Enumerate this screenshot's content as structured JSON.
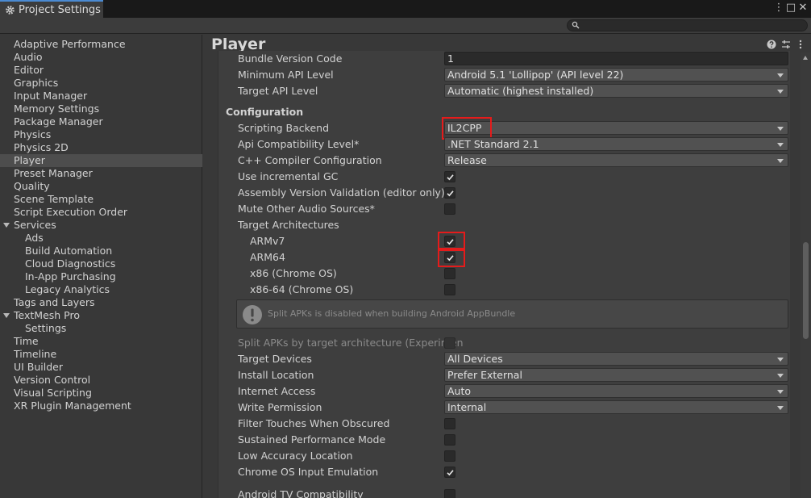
{
  "window": {
    "tab_title": "Project Settings",
    "controls": [
      "⋮",
      "□",
      "✕"
    ]
  },
  "search": {
    "placeholder": "",
    "value": ""
  },
  "sidebar": {
    "items": [
      {
        "label": "Adaptive Performance",
        "indent": 0
      },
      {
        "label": "Audio",
        "indent": 0
      },
      {
        "label": "Editor",
        "indent": 0
      },
      {
        "label": "Graphics",
        "indent": 0
      },
      {
        "label": "Input Manager",
        "indent": 0
      },
      {
        "label": "Memory Settings",
        "indent": 0
      },
      {
        "label": "Package Manager",
        "indent": 0
      },
      {
        "label": "Physics",
        "indent": 0
      },
      {
        "label": "Physics 2D",
        "indent": 0
      },
      {
        "label": "Player",
        "indent": 0,
        "selected": true
      },
      {
        "label": "Preset Manager",
        "indent": 0
      },
      {
        "label": "Quality",
        "indent": 0
      },
      {
        "label": "Scene Template",
        "indent": 0
      },
      {
        "label": "Script Execution Order",
        "indent": 0
      },
      {
        "label": "Services",
        "indent": 0,
        "expanded": true
      },
      {
        "label": "Ads",
        "indent": 1
      },
      {
        "label": "Build Automation",
        "indent": 1
      },
      {
        "label": "Cloud Diagnostics",
        "indent": 1
      },
      {
        "label": "In-App Purchasing",
        "indent": 1
      },
      {
        "label": "Legacy Analytics",
        "indent": 1
      },
      {
        "label": "Tags and Layers",
        "indent": 0
      },
      {
        "label": "TextMesh Pro",
        "indent": 0,
        "expanded": true
      },
      {
        "label": "Settings",
        "indent": 1
      },
      {
        "label": "Time",
        "indent": 0
      },
      {
        "label": "Timeline",
        "indent": 0
      },
      {
        "label": "UI Builder",
        "indent": 0
      },
      {
        "label": "Version Control",
        "indent": 0
      },
      {
        "label": "Visual Scripting",
        "indent": 0
      },
      {
        "label": "XR Plugin Management",
        "indent": 0
      }
    ]
  },
  "main": {
    "title": "Player",
    "rows": [
      {
        "label": "Bundle Version Code",
        "type": "text",
        "value": "1"
      },
      {
        "label": "Minimum API Level",
        "type": "dropdown",
        "value": "Android 5.1 'Lollipop' (API level 22)"
      },
      {
        "label": "Target API Level",
        "type": "dropdown",
        "value": "Automatic (highest installed)"
      },
      {
        "label": "Configuration",
        "type": "section"
      },
      {
        "label": "Scripting Backend",
        "type": "dropdown",
        "value": "IL2CPP",
        "highlight": true
      },
      {
        "label": "Api Compatibility Level*",
        "type": "dropdown",
        "value": ".NET Standard 2.1"
      },
      {
        "label": "C++ Compiler Configuration",
        "type": "dropdown",
        "value": "Release"
      },
      {
        "label": "Use incremental GC",
        "type": "checkbox",
        "checked": true
      },
      {
        "label": "Assembly Version Validation (editor only)",
        "type": "checkbox",
        "checked": true
      },
      {
        "label": "Mute Other Audio Sources*",
        "type": "checkbox",
        "checked": false
      },
      {
        "label": "Target Architectures",
        "type": "label"
      },
      {
        "label": "ARMv7",
        "type": "checkbox",
        "checked": true,
        "sub": true,
        "highlight": true
      },
      {
        "label": "ARM64",
        "type": "checkbox",
        "checked": true,
        "sub": true,
        "highlight": true
      },
      {
        "label": "x86 (Chrome OS)",
        "type": "checkbox",
        "checked": false,
        "sub": true
      },
      {
        "label": "x86-64 (Chrome OS)",
        "type": "checkbox",
        "checked": false,
        "sub": true
      },
      {
        "type": "help",
        "message": "Split APKs is disabled when building Android AppBundle"
      },
      {
        "label": "Split APKs by target architecture (Experimen",
        "type": "checkbox",
        "checked": false,
        "disabled": true
      },
      {
        "label": "Target Devices",
        "type": "dropdown",
        "value": "All Devices"
      },
      {
        "label": "Install Location",
        "type": "dropdown",
        "value": "Prefer External"
      },
      {
        "label": "Internet Access",
        "type": "dropdown",
        "value": "Auto"
      },
      {
        "label": "Write Permission",
        "type": "dropdown",
        "value": "Internal"
      },
      {
        "label": "Filter Touches When Obscured",
        "type": "checkbox",
        "checked": false
      },
      {
        "label": "Sustained Performance Mode",
        "type": "checkbox",
        "checked": false
      },
      {
        "label": "Low Accuracy Location",
        "type": "checkbox",
        "checked": false
      },
      {
        "label": "Chrome OS Input Emulation",
        "type": "checkbox",
        "checked": true
      },
      {
        "label": "Android TV Compatibility",
        "type": "checkbox",
        "checked": false
      }
    ]
  },
  "colors": {
    "accent": "#4a8ad2",
    "highlight_box": "#e51b1b",
    "selected_row": "#4d4d4d"
  }
}
